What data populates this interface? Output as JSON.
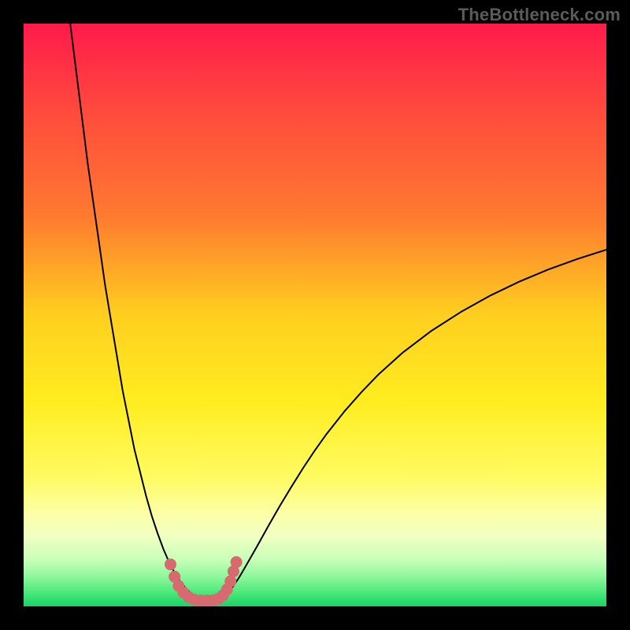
{
  "watermark": "TheBottleneck.com",
  "chart_data": {
    "type": "line",
    "title": "",
    "xlabel": "",
    "ylabel": "",
    "xlim": [
      0,
      100
    ],
    "ylim": [
      0,
      100
    ],
    "grid": false,
    "legend": false,
    "background": {
      "stops": [
        {
          "offset": 0.0,
          "color": "#ff1a4b"
        },
        {
          "offset": 0.15,
          "color": "#ff4a3d"
        },
        {
          "offset": 0.33,
          "color": "#ff7a30"
        },
        {
          "offset": 0.5,
          "color": "#ffcf1f"
        },
        {
          "offset": 0.65,
          "color": "#ffed20"
        },
        {
          "offset": 0.78,
          "color": "#fffb63"
        },
        {
          "offset": 0.84,
          "color": "#fcffa6"
        },
        {
          "offset": 0.88,
          "color": "#f0ffc2"
        },
        {
          "offset": 0.92,
          "color": "#c8ffb8"
        },
        {
          "offset": 0.95,
          "color": "#8cf79a"
        },
        {
          "offset": 0.975,
          "color": "#4fe87c"
        },
        {
          "offset": 1.0,
          "color": "#19d463"
        }
      ]
    },
    "series": [
      {
        "name": "bottleneck-curve",
        "stroke": "#000000",
        "stroke_width": 2,
        "x": [
          8,
          9,
          10,
          11,
          12,
          13,
          14,
          15,
          16,
          17,
          18,
          19,
          20,
          21,
          22,
          23,
          24,
          25,
          26,
          27,
          28,
          29,
          30,
          31,
          32,
          33,
          34,
          35,
          36,
          37,
          38,
          40,
          42,
          44,
          46,
          48,
          50,
          52,
          55,
          58,
          61,
          65,
          70,
          75,
          80,
          85,
          90,
          95,
          100
        ],
        "y": [
          100,
          92,
          84,
          76,
          69,
          62,
          55,
          49,
          43,
          37,
          32,
          27,
          23,
          19,
          15.5,
          12.5,
          9.8,
          7.5,
          5.6,
          4.1,
          2.9,
          2.0,
          1.4,
          1.05,
          1.0,
          1.08,
          1.5,
          2.3,
          3.5,
          5.0,
          6.7,
          10.2,
          13.8,
          17.3,
          20.6,
          23.8,
          26.8,
          29.6,
          33.4,
          36.8,
          39.9,
          43.5,
          47.3,
          50.5,
          53.3,
          55.7,
          57.8,
          59.6,
          61.2
        ]
      }
    ],
    "markers": {
      "name": "valley-markers",
      "fill": "#d66a6f",
      "radius": 7.5,
      "points": [
        {
          "x": 25.2,
          "y": 7.2
        },
        {
          "x": 25.9,
          "y": 5.1
        },
        {
          "x": 26.6,
          "y": 3.5
        },
        {
          "x": 27.4,
          "y": 2.4
        },
        {
          "x": 28.3,
          "y": 1.6
        },
        {
          "x": 29.3,
          "y": 1.15
        },
        {
          "x": 30.4,
          "y": 1.0
        },
        {
          "x": 31.5,
          "y": 1.0
        },
        {
          "x": 32.5,
          "y": 1.05
        },
        {
          "x": 33.4,
          "y": 1.3
        },
        {
          "x": 34.2,
          "y": 1.9
        },
        {
          "x": 34.9,
          "y": 2.9
        },
        {
          "x": 35.5,
          "y": 4.3
        },
        {
          "x": 36.0,
          "y": 6.0
        },
        {
          "x": 36.5,
          "y": 7.6
        }
      ]
    }
  }
}
